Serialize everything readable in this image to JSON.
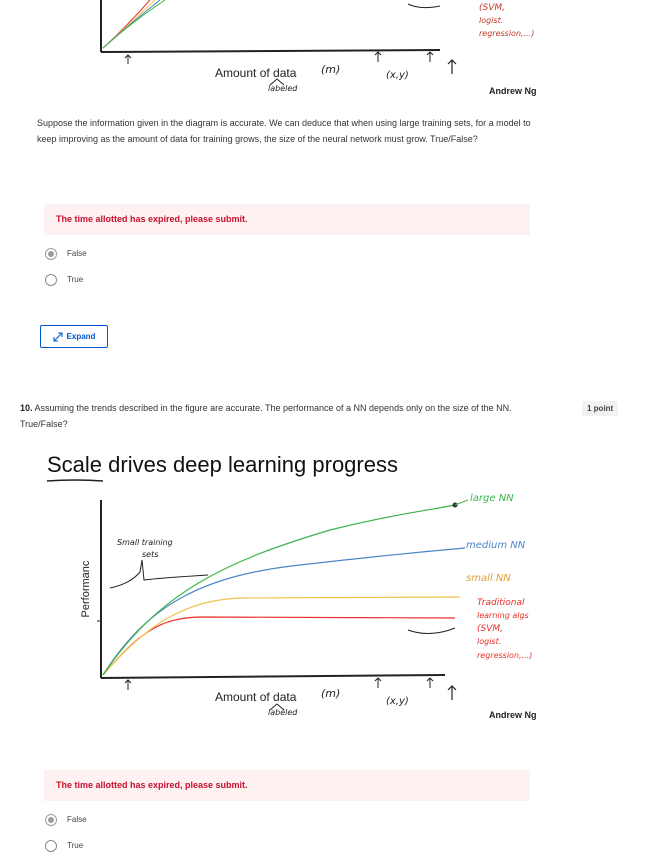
{
  "top_figure": {
    "xlabel": "Amount of data",
    "m_label": "(m)",
    "labeled_note": "labeled",
    "xy_note": "(x,y)",
    "notes": [
      "(SVM,",
      "logist.",
      "regression,...)"
    ],
    "credit": "Andrew Ng"
  },
  "q9": {
    "text": "Suppose the information given in the diagram is accurate. We can deduce that when using large training sets, for a model to keep improving as the amount of data for training grows, the size of the neural network must grow. True/False?",
    "banner": "The time allotted has expired, please submit.",
    "options": [
      {
        "label": "False",
        "selected": true
      },
      {
        "label": "True",
        "selected": false
      }
    ],
    "expand_label": "Expand"
  },
  "q10": {
    "number": "10.",
    "text": "Assuming the trends described in the figure are accurate. The performance of a NN depends only on the size of the NN. True/False?",
    "points": "1 point",
    "figure": {
      "title": "Scale drives deep learning progress",
      "ylabel": "Performanc",
      "xlabel": "Amount of data",
      "m_label": "(m)",
      "labeled_note": "labeled",
      "xy_note": "(x,y)",
      "small_sets_note": [
        "Small training",
        "sets"
      ],
      "legend": [
        "large NN",
        "medium NN",
        "small NN",
        "Traditional",
        "learning algs",
        "(SVM,",
        "logist.",
        "regression,...)"
      ],
      "credit": "Andrew Ng",
      "colors": {
        "large": "#3cb44b",
        "medium": "#4a86c8",
        "small": "#f0c24a",
        "traditional": "#e8302a",
        "ink": "#222222"
      }
    },
    "banner": "The time allotted has expired, please submit.",
    "options": [
      {
        "label": "False",
        "selected": true
      },
      {
        "label": "True",
        "selected": false
      }
    ]
  }
}
